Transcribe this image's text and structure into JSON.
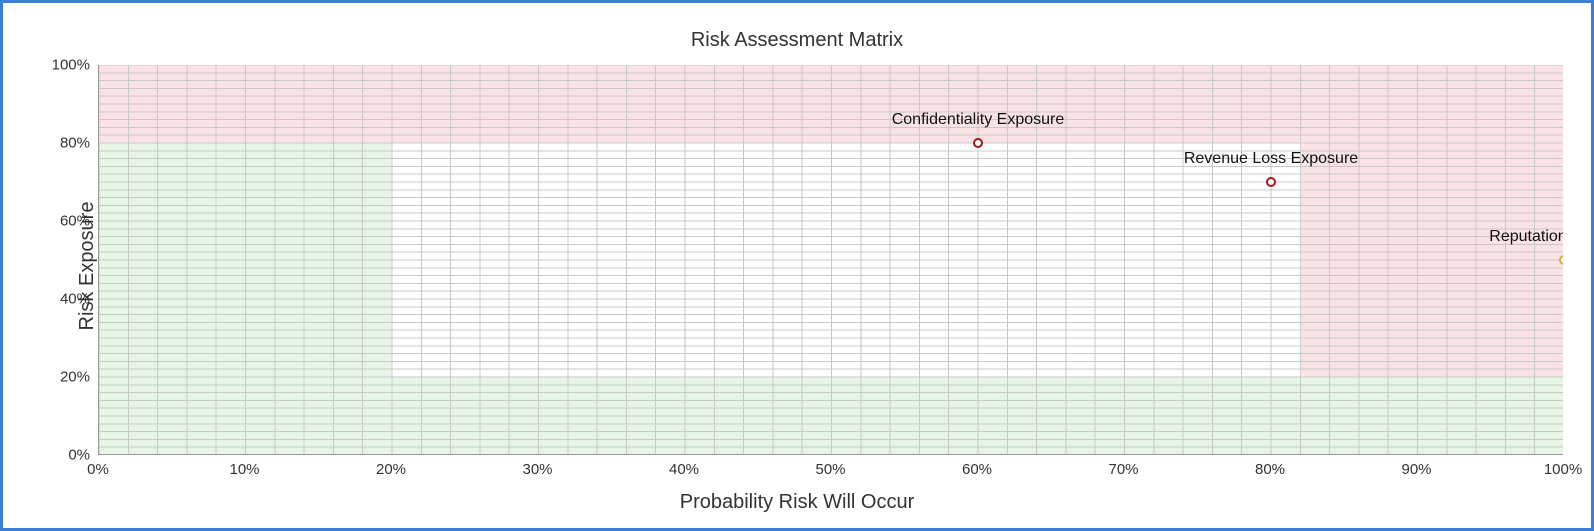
{
  "chart_data": {
    "type": "scatter",
    "title": "Risk Assessment Matrix",
    "xlabel": "Probability Risk Will Occur",
    "ylabel": "Risk Exposure",
    "xlim": [
      0,
      100
    ],
    "ylim": [
      0,
      100
    ],
    "x_ticks": [
      0,
      10,
      20,
      30,
      40,
      50,
      60,
      70,
      80,
      90,
      100
    ],
    "y_ticks": [
      0,
      20,
      40,
      60,
      80,
      100
    ],
    "tick_suffix": "%",
    "minor_grid_step": 2,
    "zones": [
      {
        "name": "low-left-green",
        "color": "green",
        "x0": 0,
        "x1": 20,
        "y0": 0,
        "y1": 80
      },
      {
        "name": "bottom-strip-green",
        "color": "green",
        "x0": 20,
        "x1": 82,
        "y0": 0,
        "y1": 20
      },
      {
        "name": "top-strip-pink",
        "color": "pink",
        "x0": 0,
        "x1": 82,
        "y0": 80,
        "y1": 100
      },
      {
        "name": "right-block-pink",
        "color": "pink",
        "x0": 82,
        "x1": 100,
        "y0": 20,
        "y1": 100
      },
      {
        "name": "bottom-right-green",
        "color": "green",
        "x0": 82,
        "x1": 100,
        "y0": 0,
        "y1": 20
      }
    ],
    "series": [
      {
        "name": "risk-points",
        "points": [
          {
            "label": "Confidentiality Exposure",
            "x": 60,
            "y": 80,
            "color": "#a3181f"
          },
          {
            "label": "Revenue Loss Exposure",
            "x": 80,
            "y": 70,
            "color": "#a3181f"
          },
          {
            "label": "Reputation Exposure",
            "x": 100,
            "y": 50,
            "color": "#e9a23b"
          }
        ]
      }
    ]
  }
}
